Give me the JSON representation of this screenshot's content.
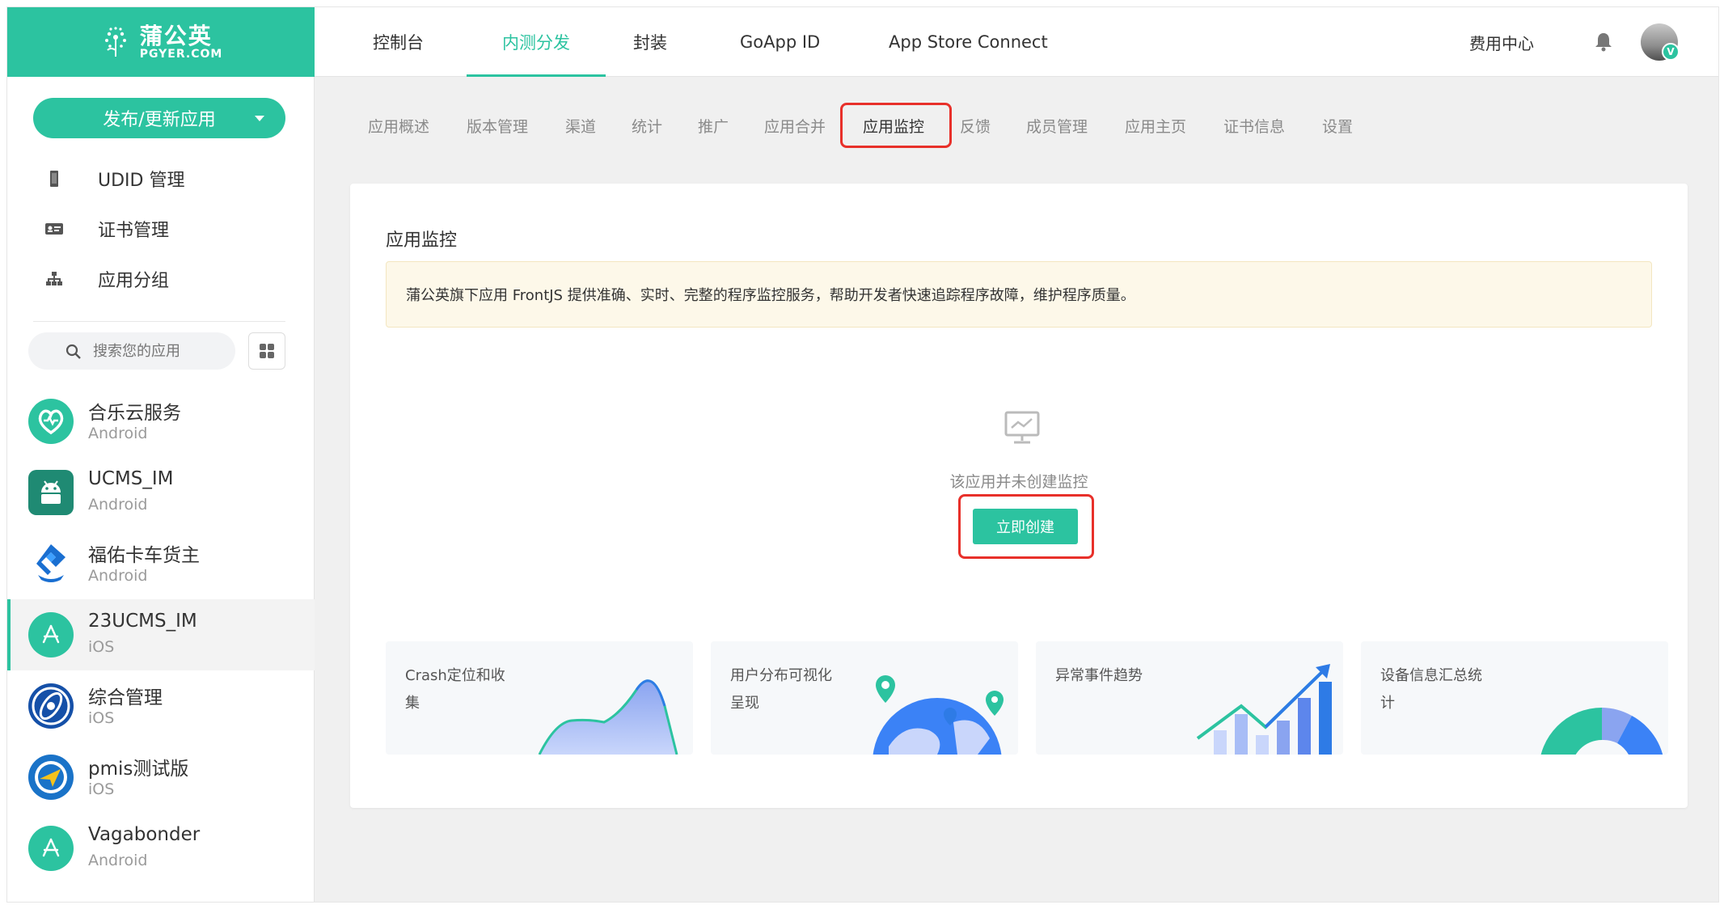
{
  "brand": {
    "name_cn": "蒲公英",
    "name_en": "PGYER.COM",
    "accent": "#2cc3a0",
    "highlight": "#e8302a"
  },
  "sidebar": {
    "publish_label": "发布/更新应用",
    "nav": [
      {
        "label": "UDID 管理",
        "icon": "device-icon"
      },
      {
        "label": "证书管理",
        "icon": "certificate-icon"
      },
      {
        "label": "应用分组",
        "icon": "group-icon"
      }
    ],
    "search_placeholder": "搜索您的应用",
    "apps": [
      {
        "name": "合乐云服务",
        "platform": "Android",
        "icon": "heart-chart-icon",
        "active": false
      },
      {
        "name": "UCMS_IM",
        "platform": "Android",
        "icon": "android-icon",
        "active": false
      },
      {
        "name": "福佑卡车货主",
        "platform": "Android",
        "icon": "truck-logo-icon",
        "active": false
      },
      {
        "name": "23UCMS_IM",
        "platform": "iOS",
        "icon": "app-store-icon",
        "active": true
      },
      {
        "name": "综合管理",
        "platform": "iOS",
        "icon": "globe-logo-icon",
        "active": false
      },
      {
        "name": "pmis测试版",
        "platform": "iOS",
        "icon": "plane-logo-icon",
        "active": false
      },
      {
        "name": "Vagabonder",
        "platform": "Android",
        "icon": "app-store-icon",
        "active": false
      }
    ]
  },
  "topnav": {
    "tabs": [
      {
        "label": "控制台",
        "active": false
      },
      {
        "label": "内测分发",
        "active": true
      },
      {
        "label": "封装",
        "active": false
      },
      {
        "label": "GoApp ID",
        "active": false
      },
      {
        "label": "App Store Connect",
        "active": false
      }
    ],
    "fee_center": "费用中心",
    "avatar_badge": "V"
  },
  "subnav": {
    "tabs": [
      {
        "label": "应用概述",
        "active": false
      },
      {
        "label": "版本管理",
        "active": false
      },
      {
        "label": "渠道",
        "active": false
      },
      {
        "label": "统计",
        "active": false
      },
      {
        "label": "推广",
        "active": false
      },
      {
        "label": "应用合并",
        "active": false
      },
      {
        "label": "应用监控",
        "active": true
      },
      {
        "label": "反馈",
        "active": false
      },
      {
        "label": "成员管理",
        "active": false
      },
      {
        "label": "应用主页",
        "active": false
      },
      {
        "label": "证书信息",
        "active": false
      },
      {
        "label": "设置",
        "active": false
      }
    ]
  },
  "main": {
    "title": "应用监控",
    "notice": "蒲公英旗下应用 FrontJS 提供准确、实时、完整的程序监控服务，帮助开发者快速追踪程序故障，维护程序质量。",
    "empty_text": "该应用并未创建监控",
    "create_label": "立即创建",
    "features": [
      {
        "label": "Crash定位和收集"
      },
      {
        "label": "用户分布可视化呈现"
      },
      {
        "label": "异常事件趋势"
      },
      {
        "label": "设备信息汇总统计"
      }
    ]
  }
}
